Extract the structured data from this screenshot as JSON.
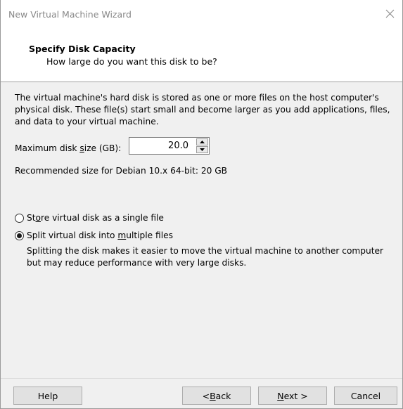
{
  "window": {
    "title": "New Virtual Machine Wizard"
  },
  "header": {
    "title": "Specify Disk Capacity",
    "subtitle": "How large do you want this disk to be?"
  },
  "description": "The virtual machine's hard disk is stored as one or more files on the host computer's physical disk. These file(s) start small and become larger as you add applications, files, and data to your virtual machine.",
  "disk_size": {
    "label_before": "Maximum disk ",
    "label_accel": "s",
    "label_after": "ize (GB):",
    "value": "20.0"
  },
  "recommended": "Recommended size for Debian 10.x 64-bit: 20 GB",
  "options": {
    "single": {
      "before": "St",
      "accel": "o",
      "after": "re virtual disk as a single file",
      "checked": false
    },
    "multiple": {
      "before": "Split virtual disk into ",
      "accel": "m",
      "after": "ultiple files",
      "checked": true
    },
    "multiple_description": "Splitting the disk makes it easier to move the virtual machine to another computer but may reduce performance with very large disks."
  },
  "buttons": {
    "help": "Help",
    "back_prefix": "< ",
    "back_accel": "B",
    "back_rest": "ack",
    "next_accel": "N",
    "next_rest": "ext >",
    "cancel": "Cancel"
  },
  "icons": {
    "close": "close-icon",
    "spin_up": "chevron-up-icon",
    "spin_down": "chevron-down-icon"
  }
}
